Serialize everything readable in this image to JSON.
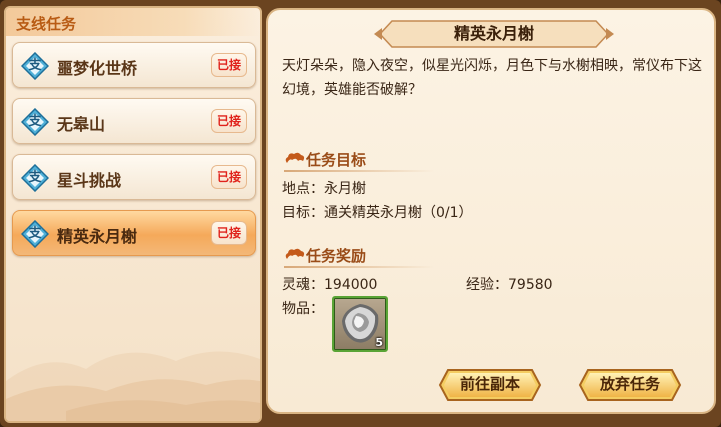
{
  "sidebar": {
    "title": "支线任务",
    "badge_char": "支",
    "accepted_label": "已接",
    "items": [
      {
        "label": "噩梦化世桥"
      },
      {
        "label": "无皋山"
      },
      {
        "label": "星斗挑战"
      },
      {
        "label": "精英永月榭"
      }
    ],
    "selected_index": 3
  },
  "detail": {
    "title": "精英永月榭",
    "description": "天灯朵朵，隐入夜空，似星光闪烁，月色下与水榭相映，常仪布下这幻境，英雄能否破解？",
    "objective": {
      "heading": "任务目标",
      "location_line": "地点：永月榭",
      "target_line": "目标：通关精英永月榭（0/1）"
    },
    "reward": {
      "heading": "任务奖励",
      "soul_line": "灵魂：194000",
      "exp_line": "经验：79580",
      "items_label": "物品：",
      "item_count": "5",
      "item_icon": "shield-item-icon"
    }
  },
  "buttons": {
    "goto_dungeon": "前往副本",
    "abandon_quest": "放弃任务"
  },
  "colors": {
    "accent": "#b85b14",
    "accepted": "#e0231c",
    "selected_item": "#f5a95a"
  }
}
